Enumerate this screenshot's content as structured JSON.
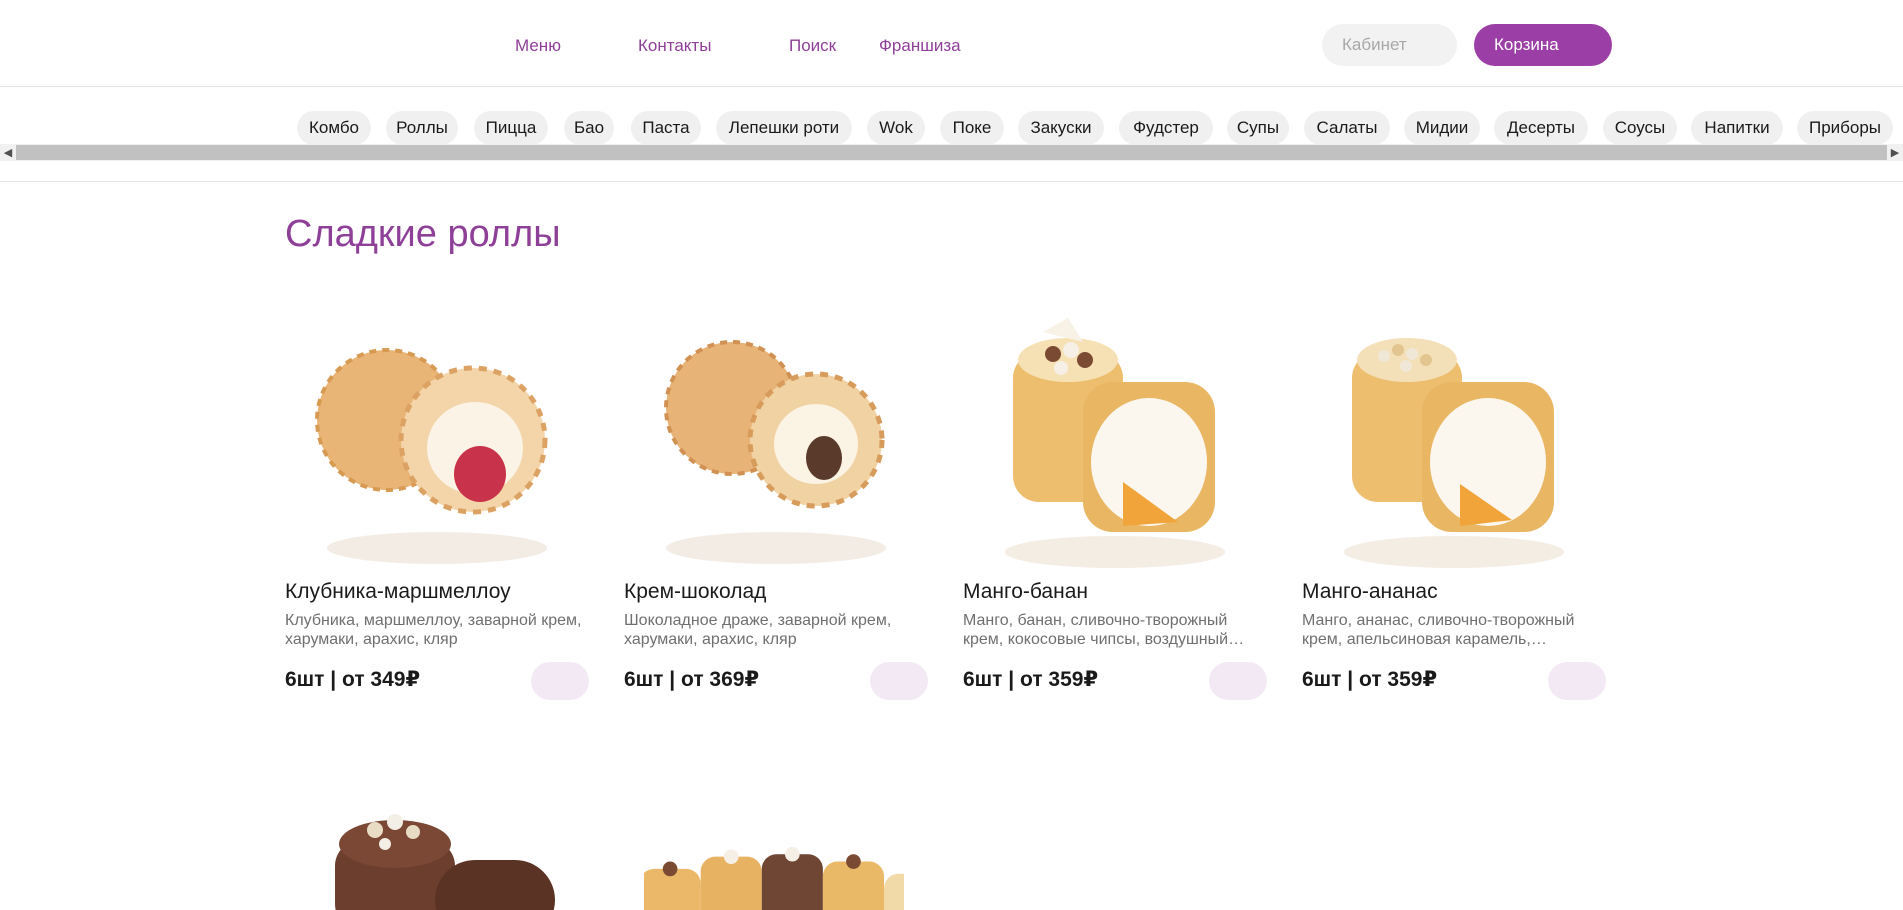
{
  "nav": {
    "menu": "Меню",
    "contacts": "Контакты",
    "search": "Поиск",
    "franchise": "Франшиза"
  },
  "header": {
    "cabinet": "Кабинет",
    "cart": "Корзина"
  },
  "categories": [
    "Комбо",
    "Роллы",
    "Пицца",
    "Бао",
    "Паста",
    "Лепешки роти",
    "Wok",
    "Поке",
    "Закуски",
    "Фудстер",
    "Супы",
    "Салаты",
    "Мидии",
    "Десерты",
    "Соусы",
    "Напитки",
    "Приборы"
  ],
  "section": {
    "title": "Сладкие роллы"
  },
  "products": [
    {
      "name": "Клубника-маршмеллоу",
      "desc": "Клубника, маршмеллоу, заварной крем, харумаки, арахис, кляр",
      "price": "6шт | от 349₽"
    },
    {
      "name": "Крем-шоколад",
      "desc": "Шоколадное драже, заварной крем, харумаки, арахис, кляр",
      "price": "6шт | от 369₽"
    },
    {
      "name": "Манго-банан",
      "desc": "Манго, банан, сливочно-творожный крем, кокосовые чипсы, воздушный…",
      "price": "6шт | от 359₽"
    },
    {
      "name": "Манго-ананас",
      "desc": "Манго, ананас, сливочно-творожный крем, апельсиновая карамель,…",
      "price": "6шт | от 359₽"
    }
  ],
  "colors": {
    "accent": "#9b3ea5",
    "accent_text": "#8e3f98",
    "add_button": "#f3e9f4"
  }
}
